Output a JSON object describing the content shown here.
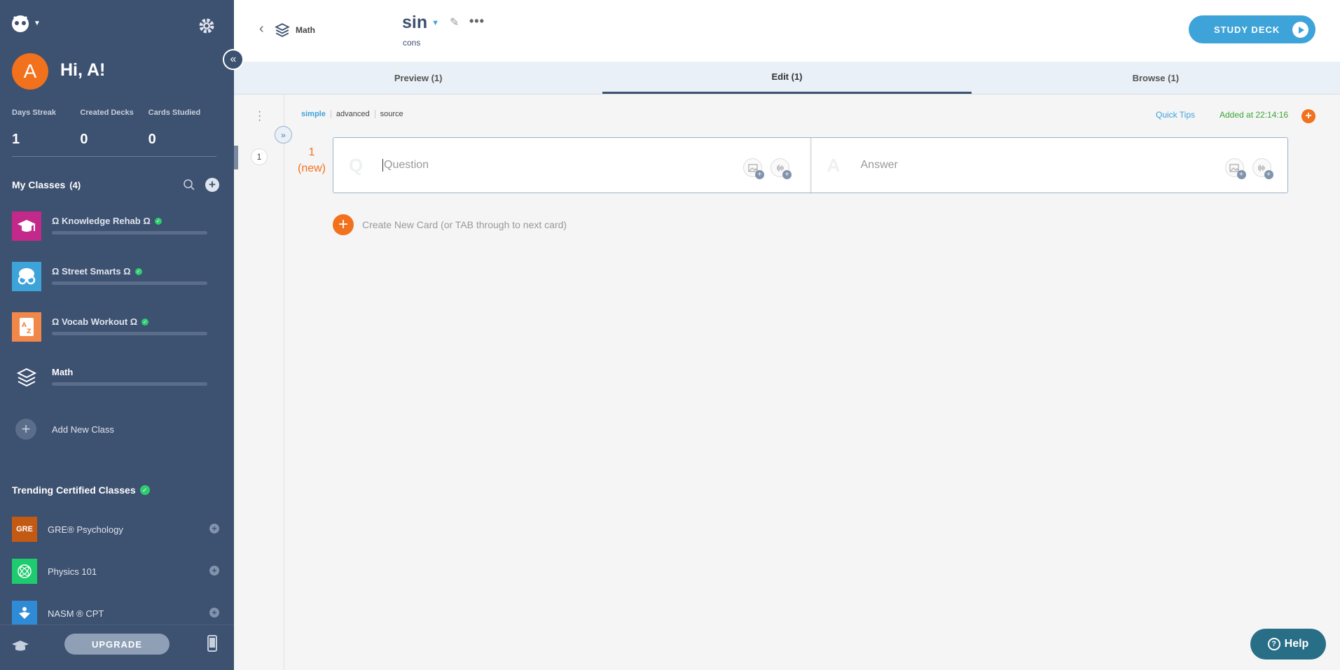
{
  "sidebar": {
    "avatar_letter": "A",
    "greeting": "Hi, A!",
    "stats": [
      {
        "label": "Days Streak",
        "value": "1"
      },
      {
        "label": "Created Decks",
        "value": "0"
      },
      {
        "label": "Cards Studied",
        "value": "0"
      }
    ],
    "classes_title": "My Classes",
    "classes_count": "(4)",
    "classes": [
      {
        "name": "Ω Knowledge Rehab Ω",
        "certified": true,
        "color": "#c2298b"
      },
      {
        "name": "Ω Street Smarts Ω",
        "certified": true,
        "color": "#3da3d9"
      },
      {
        "name": "Ω Vocab Workout Ω",
        "certified": true,
        "color": "#f2874a"
      },
      {
        "name": "Math",
        "certified": false,
        "color": "#3d5170"
      }
    ],
    "add_class_label": "Add New Class",
    "trending_title": "Trending Certified Classes",
    "trending": [
      {
        "name": "GRE® Psychology",
        "thumb": "GRE",
        "color": "#c35a14"
      },
      {
        "name": "Physics 101",
        "thumb": "",
        "color": "#1ecb6f"
      },
      {
        "name": "NASM ® CPT",
        "thumb": "",
        "color": "#2f8bd6"
      }
    ],
    "upgrade_label": "UPGRADE"
  },
  "header": {
    "breadcrumb": "Math",
    "deck_title": "sin",
    "deck_subtitle": "cons",
    "study_label": "STUDY DECK"
  },
  "tabs": [
    {
      "label": "Preview (1)",
      "active": false
    },
    {
      "label": "Edit (1)",
      "active": true
    },
    {
      "label": "Browse (1)",
      "active": false
    }
  ],
  "editor": {
    "modes": [
      "simple",
      "advanced",
      "source"
    ],
    "quick_tips": "Quick Tips",
    "added_at": "Added at 22:14:16",
    "gutter_number": "1",
    "card_index": "1",
    "card_status": "(new)",
    "question_letter": "Q",
    "question_placeholder": "Question",
    "answer_letter": "A",
    "answer_placeholder": "Answer",
    "create_label": "Create New Card (or TAB through to next card)"
  },
  "help_label": "Help"
}
